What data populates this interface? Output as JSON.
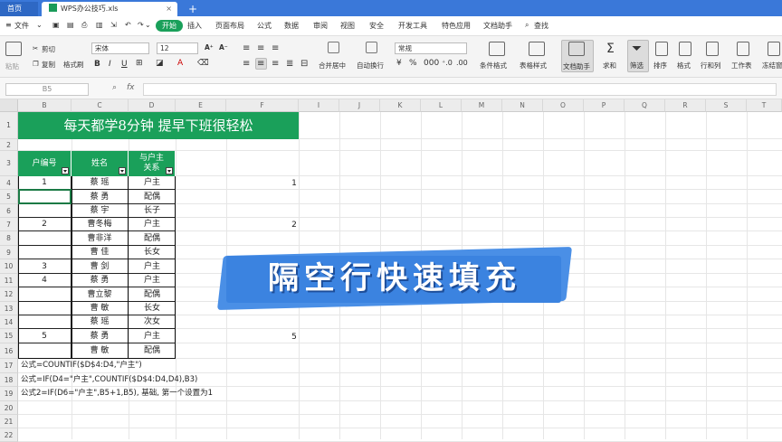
{
  "tabs": {
    "home": "首页",
    "file": "WPS办公技巧.xls"
  },
  "menu": {
    "file": "文件",
    "items": [
      "开始",
      "插入",
      "页面布局",
      "公式",
      "数据",
      "审阅",
      "视图",
      "安全",
      "开发工具",
      "特色应用",
      "文档助手"
    ],
    "search": "查找"
  },
  "toolbar": {
    "cut": "剪切",
    "copy": "复制",
    "format_painter": "格式刷",
    "paste": "粘贴",
    "font_name": "宋体",
    "font_size": "12",
    "merge": "合并居中",
    "wrap": "自动换行",
    "number_format": "常规",
    "cond_format": "条件格式",
    "table_style": "表格样式",
    "doc_helper": "文档助手",
    "sum": "求和",
    "filter": "筛选",
    "sort": "排序",
    "format": "格式",
    "rowcol": "行和列",
    "sheet": "工作表",
    "freeze": "冻结窗"
  },
  "formula_bar": {
    "name_box": "B5",
    "fx": "fx"
  },
  "columns": [
    "B",
    "C",
    "D",
    "E",
    "F",
    "I",
    "J",
    "K",
    "L",
    "M",
    "N",
    "O",
    "P",
    "Q",
    "R",
    "S",
    "T"
  ],
  "rows": [
    "1",
    "2",
    "3",
    "4",
    "5",
    "6",
    "7",
    "8",
    "9",
    "10",
    "11",
    "12",
    "13",
    "14",
    "15",
    "16",
    "17",
    "18",
    "19",
    "20",
    "21",
    "22"
  ],
  "sheet": {
    "title": "每天都学8分钟  提早下班很轻松",
    "headers": [
      "户编号",
      "姓名",
      "与户主\n关系"
    ],
    "records": [
      {
        "id": "1",
        "name": "蔡    瑶",
        "rel": "户主"
      },
      {
        "id": "",
        "name": "蔡    勇",
        "rel": "配偶"
      },
      {
        "id": "",
        "name": "蔡    宇",
        "rel": "长子"
      },
      {
        "id": "2",
        "name": "曹冬梅",
        "rel": "户主"
      },
      {
        "id": "",
        "name": "曹非洋",
        "rel": "配偶"
      },
      {
        "id": "",
        "name": "曹    佳",
        "rel": "长女"
      },
      {
        "id": "3",
        "name": "曹    剑",
        "rel": "户主"
      },
      {
        "id": "4",
        "name": "蔡    勇",
        "rel": "户主"
      },
      {
        "id": "",
        "name": "曹立黎",
        "rel": "配偶"
      },
      {
        "id": "",
        "name": "曹    敏",
        "rel": "长女"
      },
      {
        "id": "",
        "name": "蔡    瑶",
        "rel": "次女"
      },
      {
        "id": "5",
        "name": "蔡    勇",
        "rel": "户主"
      },
      {
        "id": "",
        "name": "曹    敏",
        "rel": "配偶"
      }
    ],
    "side_values": [
      "1",
      "2",
      "5"
    ],
    "notes": [
      "公式=COUNTIF($D$4:D4,\"户主\")",
      "公式=IF(D4=\"户主\",COUNTIF($D$4:D4,D4),B3)",
      "公式2=IF(D6=\"户主\",B5+1,B5), 基础, 第一个设置为1"
    ]
  },
  "banner": "隔空行快速填充",
  "colors": {
    "accent": "#1aa05a",
    "titlebar": "#3a78d9",
    "banner": "#3b83e0"
  }
}
